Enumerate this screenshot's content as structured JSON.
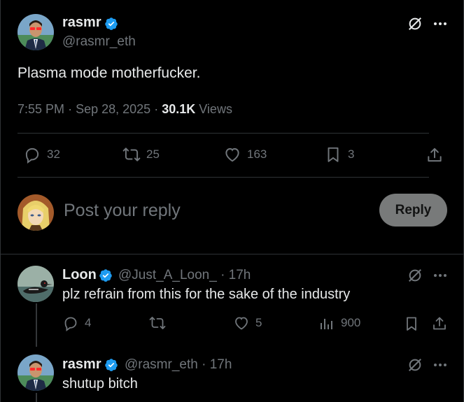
{
  "main_tweet": {
    "author_name": "rasmr",
    "author_handle": "@rasmr_eth",
    "text": "Plasma mode motherfucker.",
    "time": "7:55 PM",
    "date": "Sep 28, 2025",
    "views_count": "30.1K",
    "views_label": "Views",
    "actions": {
      "replies": "32",
      "reposts": "25",
      "likes": "163",
      "bookmarks": "3"
    }
  },
  "composer": {
    "placeholder": "Post your reply",
    "button_label": "Reply"
  },
  "replies": [
    {
      "author_name": "Loon",
      "author_handle": "@Just_A_Loon_",
      "age": "17h",
      "text": "plz refrain from this for the sake of the industry",
      "actions": {
        "replies": "4",
        "reposts": "",
        "likes": "5",
        "views": "900"
      }
    },
    {
      "author_name": "rasmr",
      "author_handle": "@rasmr_eth",
      "age": "17h",
      "text": "shutup bitch"
    }
  ],
  "colors": {
    "background": "#000000",
    "text": "#e7e9ea",
    "muted": "#71767b",
    "verified": "#1d9bf0",
    "divider": "#2f3336"
  },
  "icons": [
    "grok-icon",
    "more-icon",
    "verified-badge-icon",
    "reply-icon",
    "repost-icon",
    "like-icon",
    "bookmark-icon",
    "share-icon",
    "views-icon"
  ]
}
